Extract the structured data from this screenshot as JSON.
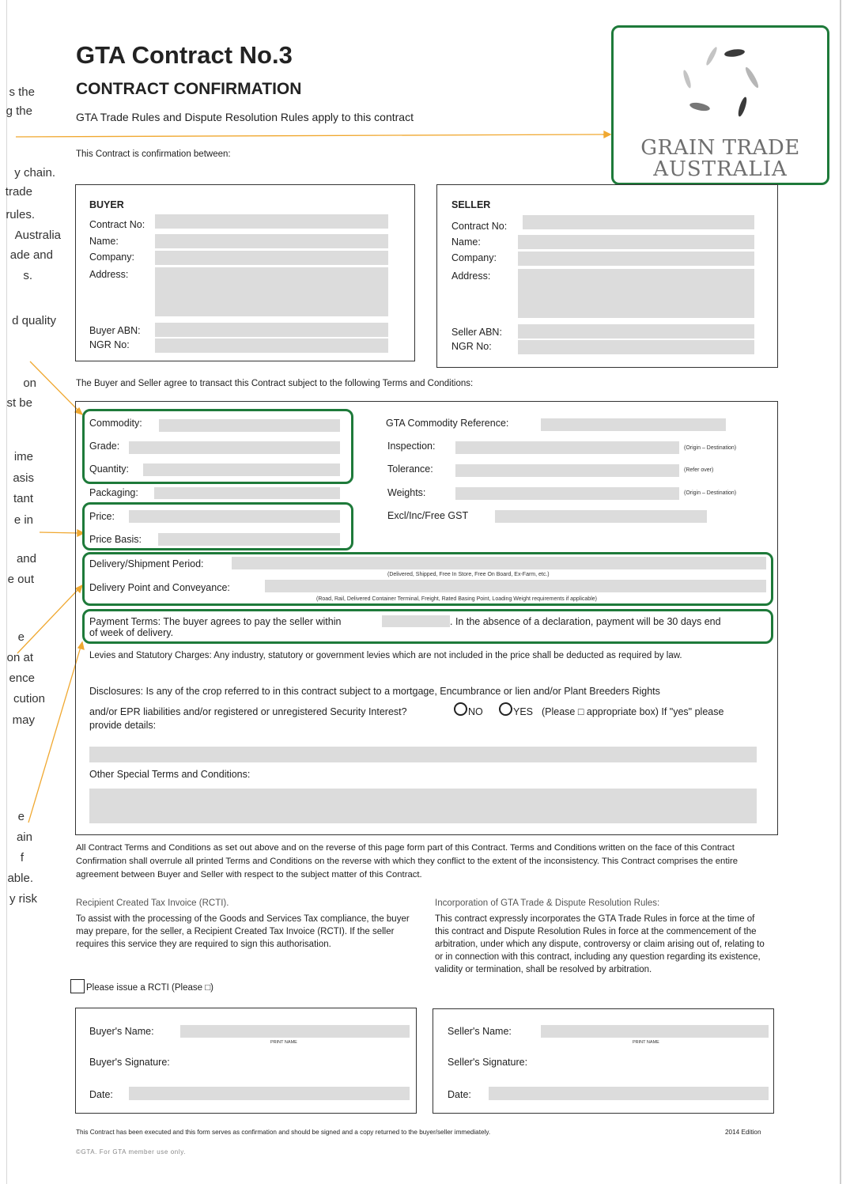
{
  "margin_text": [
    "s the",
    "g the",
    "y chain.",
    "trade",
    "rules.",
    "Australia",
    "ade and",
    "s.",
    "d quality",
    "on",
    "st be",
    "ime",
    "asis",
    "tant",
    "e in",
    "and",
    "e out",
    "e",
    "on at",
    "ence",
    "cution",
    "may",
    "e",
    "ain",
    "f",
    "able.",
    "y risk"
  ],
  "header": {
    "title": "GTA Contract No.3",
    "subtitle": "CONTRACT CONFIRMATION",
    "rules_line": "GTA Trade Rules and Dispute Resolution Rules apply to this contract",
    "intro": "This Contract is confirmation between:"
  },
  "logo": {
    "line1": "GRAIN TRADE",
    "line2": "AUSTRALIA"
  },
  "buyer_box": {
    "heading": "BUYER",
    "labels": [
      "Contract No:",
      "Name:",
      "Company:",
      "Address:",
      "Buyer ABN:",
      "NGR No:"
    ]
  },
  "seller_box": {
    "heading": "SELLER",
    "labels": [
      "Contract No:",
      "Name:",
      "Company:",
      "Address:",
      "Seller ABN:",
      "NGR No:"
    ]
  },
  "agree_line": "The Buyer and Seller agree to transact this Contract subject to the following Terms and Conditions:",
  "terms": {
    "commodity": "Commodity:",
    "grade": "Grade:",
    "quantity": "Quantity:",
    "packaging": "Packaging:",
    "price": "Price:",
    "price_basis": "Price Basis:",
    "commodity_ref": "GTA Commodity Reference:",
    "inspection": "Inspection:",
    "inspection_note": "(Origin – Destination)",
    "tolerance": "Tolerance:",
    "tolerance_note": "(Refer over)",
    "weights": "Weights:",
    "weights_note": "(Origin – Destination)",
    "gst": "Excl/Inc/Free GST",
    "delivery_period": "Delivery/Shipment Period:",
    "delivery_period_note": "(Delivered, Shipped, Free In Store, Free On Board, Ex-Farm, etc.)",
    "delivery_point": "Delivery Point and Conveyance:",
    "delivery_point_note": "(Road, Rail, Delivered Container Terminal, Freight, Rated Basing Point, Loading Weight requirements if applicable)",
    "payment_a": "Payment Terms: The buyer agrees to pay the seller within",
    "payment_b": ". In the absence of a declaration, payment will be 30 days end",
    "payment_c": "of week of delivery.",
    "levies": "Levies and Statutory Charges: Any industry, statutory or government levies which are not included in the price shall be deducted as required by law.",
    "disclosures_a": "Disclosures: Is any of the crop referred to in this contract subject to a mortgage, Encumbrance or lien and/or Plant Breeders Rights",
    "disclosures_b": "and/or EPR liabilities and/or registered or unregistered Security Interest?",
    "no": "NO",
    "yes": "YES",
    "disclosures_c": "(Please □ appropriate box) If \"yes\" please",
    "disclosures_d": "provide details:",
    "other": "Other Special Terms and Conditions:"
  },
  "all_terms": "All Contract Terms and Conditions as set out above and on the reverse of this page form part of this Contract. Terms and Conditions written on the face of this Contract Confirmation shall overrule all printed Terms and Conditions on the reverse with which they conflict to the extent of the inconsistency. This Contract comprises the entire agreement between Buyer and Seller with respect to the subject matter of this Contract.",
  "rcti": {
    "heading": "Recipient Created Tax Invoice (RCTI).",
    "body": "To assist with the processing of the Goods and Services Tax compliance, the buyer may prepare, for the seller, a Recipient Created Tax Invoice (RCTI). If the seller requires this service they are required to sign this authorisation.",
    "checkbox_label": "Please issue a RCTI (Please □)"
  },
  "incorporation": {
    "heading": "Incorporation of GTA Trade & Dispute Resolution Rules:",
    "body": "This contract expressly incorporates the GTA Trade Rules in force at the time of this contract and Dispute Resolution Rules in force at the commencement of the arbitration, under which any dispute, controversy or claim arising out of, relating to or in connection with this contract, including any question regarding its existence, validity or termination, shall be resolved by arbitration."
  },
  "sign_buyer": {
    "name": "Buyer's Name:",
    "print": "PRINT NAME",
    "signature": "Buyer's Signature:",
    "date": "Date:"
  },
  "sign_seller": {
    "name": "Seller's Name:",
    "print": "PRINT NAME",
    "signature": "Seller's Signature:",
    "date": "Date:"
  },
  "footer": {
    "executed": "This Contract has been executed and this form serves as confirmation and should be signed and a copy returned to the buyer/seller immediately.",
    "edition": "2014 Edition",
    "copyright": "©GTA. For GTA member use only."
  },
  "colors": {
    "accent_green": "#1e7a3a",
    "annotation_orange": "#f0a830",
    "field_grey": "#dcdcdc"
  }
}
